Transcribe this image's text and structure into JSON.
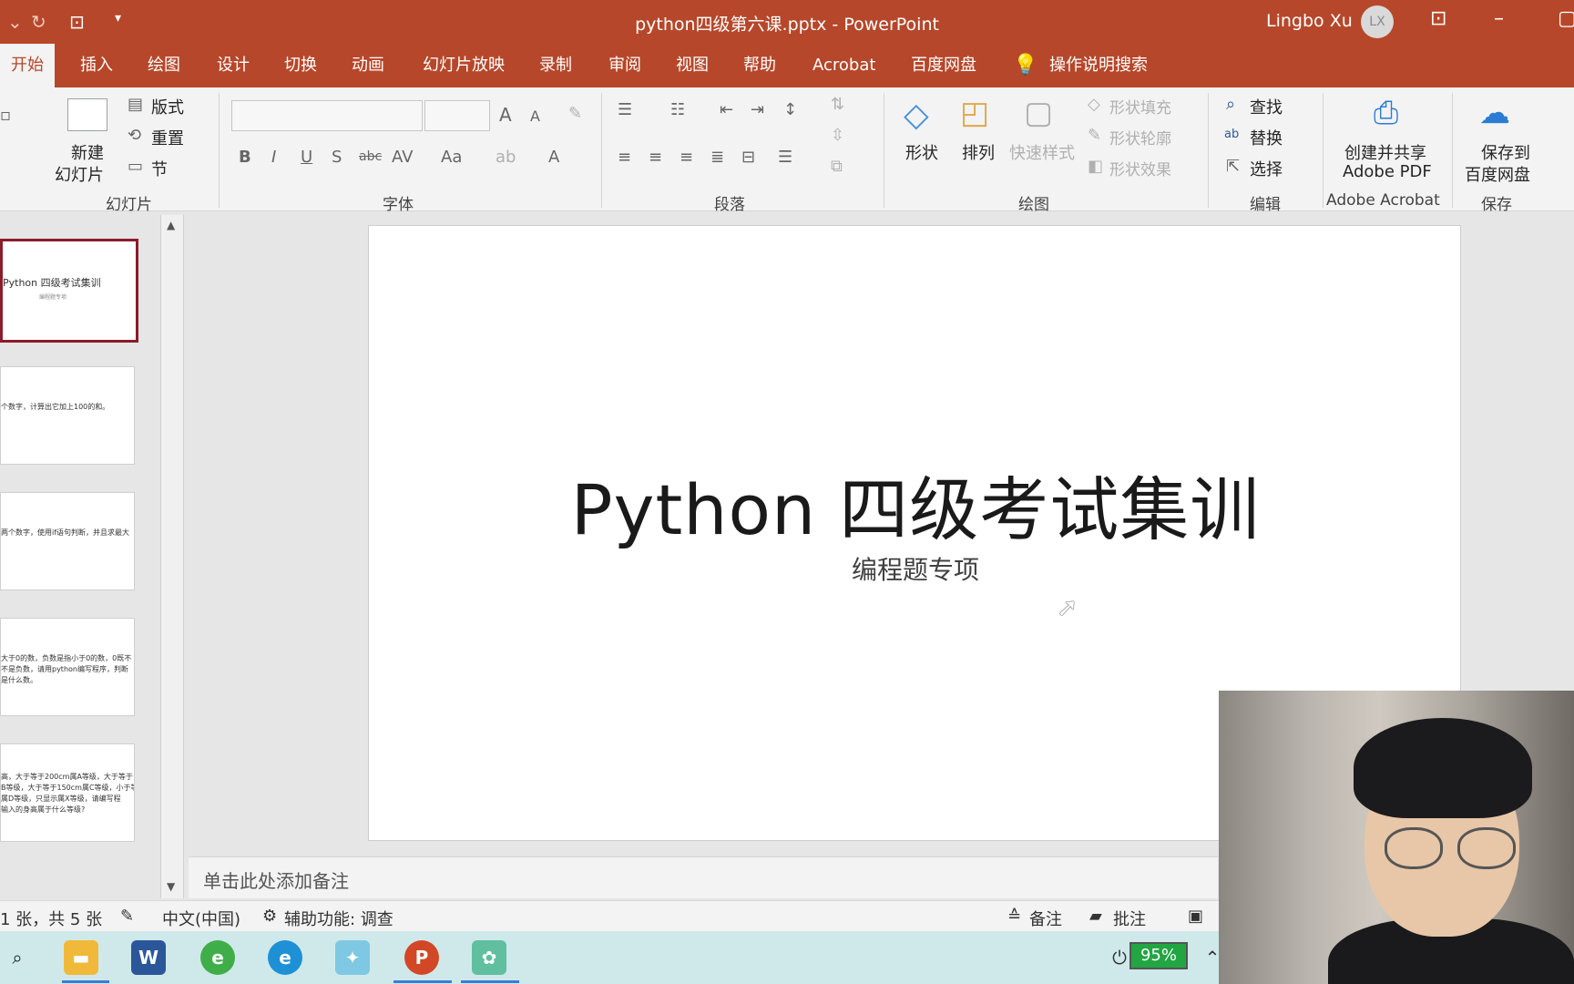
{
  "window": {
    "title": "python四级第六课.pptx  -  PowerPoint",
    "user_name": "Lingbo Xu",
    "user_initials": "LX"
  },
  "tabs": [
    {
      "label": "开始"
    },
    {
      "label": "插入"
    },
    {
      "label": "绘图"
    },
    {
      "label": "设计"
    },
    {
      "label": "切换"
    },
    {
      "label": "动画"
    },
    {
      "label": "幻灯片放映"
    },
    {
      "label": "录制"
    },
    {
      "label": "审阅"
    },
    {
      "label": "视图"
    },
    {
      "label": "帮助"
    },
    {
      "label": "Acrobat"
    },
    {
      "label": "百度网盘"
    },
    {
      "label": "操作说明搜索"
    }
  ],
  "ribbon": {
    "slides": {
      "new_slide_line1": "新建",
      "new_slide_line2": "幻灯片",
      "layout": "版式",
      "reset": "重置",
      "section": "节",
      "group_label": "幻灯片"
    },
    "font": {
      "group_label": "字体"
    },
    "paragraph": {
      "group_label": "段落"
    },
    "drawing": {
      "shapes": "形状",
      "arrange": "排列",
      "quick_styles": "快速样式",
      "shape_fill": "形状填充",
      "shape_outline": "形状轮廓",
      "shape_effects": "形状效果",
      "group_label": "绘图"
    },
    "editing": {
      "find": "查找",
      "replace": "替换",
      "select": "选择",
      "group_label": "编辑"
    },
    "acrobat": {
      "line1": "创建并共享",
      "line2": "Adobe PDF",
      "group_label": "Adobe Acrobat"
    },
    "save": {
      "line1": "保存到",
      "line2": "百度网盘",
      "group_label": "保存"
    }
  },
  "thumbnails": [
    {
      "text": "Python 四级考试集训",
      "sub": "编程题专项"
    },
    {
      "text": "个数字，计算出它加上100的和。"
    },
    {
      "text": "两个数字，使用if语句判断，并且求最大"
    },
    {
      "text": "大于0的数，负数是指小于0的数，0既不",
      "text2": "不是负数，请用python编写程序，判断",
      "text3": "是什么数。"
    },
    {
      "text": "高，大于等于200cm属A等级，大于等于",
      "text2": "B等级，大于等于150cm属C等级，小于等",
      "text3": "属D等级，只显示属X等级，请编写程",
      "text4": "输入的身高属于什么等级?"
    }
  ],
  "slide": {
    "title": "Python 四级考试集训",
    "subtitle": "编程题专项"
  },
  "notes_placeholder": "单击此处添加备注",
  "status": {
    "slide_count": "1 张，共 5 张",
    "language": "中文(中国)",
    "accessibility": "辅助功能: 调查",
    "notes": "备注",
    "comments": "批注"
  },
  "taskbar": {
    "battery": "95%"
  },
  "colors": {
    "accent": "#b7472a",
    "active_thumb_border": "#8b1c2c",
    "taskbar": "#cfe9ea"
  }
}
